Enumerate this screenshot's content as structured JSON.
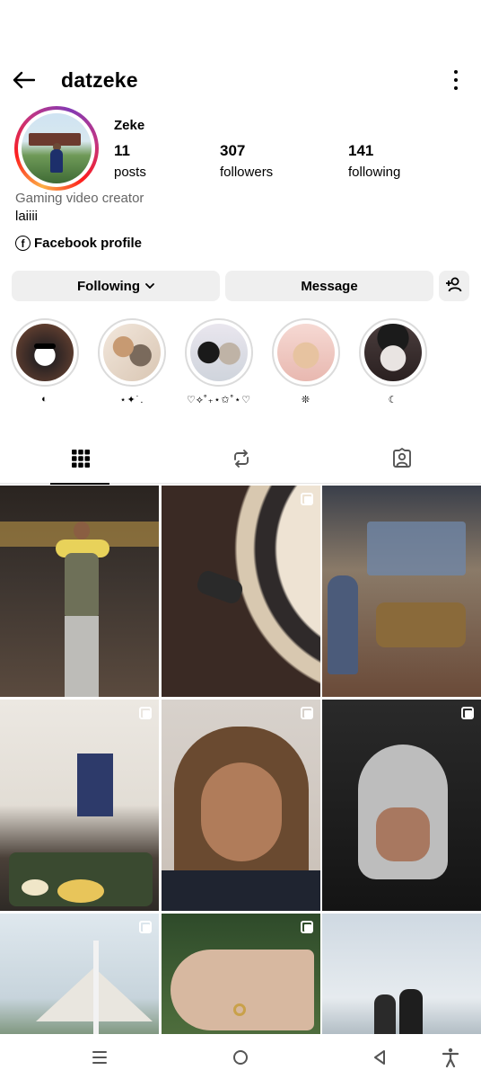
{
  "header": {
    "username": "datzeke"
  },
  "profile": {
    "full_name": "Zeke",
    "stats": [
      {
        "value": "11",
        "label": "posts"
      },
      {
        "value": "307",
        "label": "followers"
      },
      {
        "value": "141",
        "label": "following"
      }
    ],
    "bio_category": "Gaming video creator",
    "bio_text": "laiiii",
    "facebook_link": "Facebook profile"
  },
  "actions": {
    "following_label": "Following",
    "message_label": "Message"
  },
  "highlights": [
    {
      "caption": "◐"
    },
    {
      "caption": "⋆✦˙."
    },
    {
      "caption": "♡⟡˚₊⋆✩˚⋆♡"
    },
    {
      "caption": "❊"
    },
    {
      "caption": "☾"
    }
  ],
  "tabs": [
    "posts-grid-icon",
    "reposts-icon",
    "tagged-icon"
  ],
  "nav": [
    "recents-icon",
    "home-icon",
    "back-icon",
    "accessibility-icon"
  ],
  "colors": {
    "button_bg": "#efefef",
    "ring_gradient": "instagram-story"
  }
}
